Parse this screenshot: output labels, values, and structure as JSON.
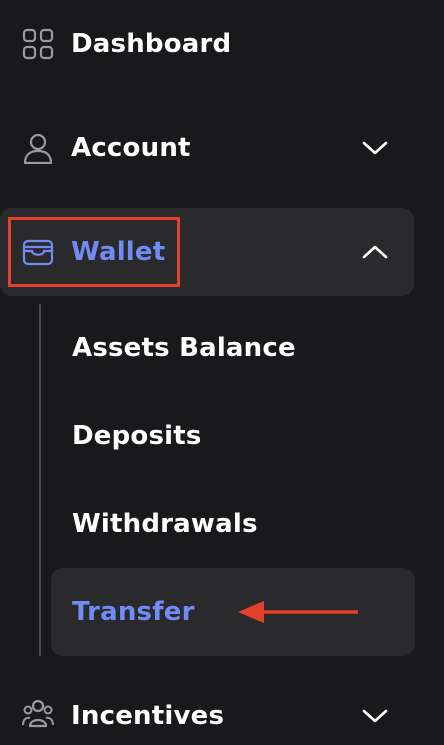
{
  "nav": {
    "dashboard": {
      "label": "Dashboard",
      "icon": "grid-icon"
    },
    "account": {
      "label": "Account",
      "icon": "user-icon",
      "state": "collapsed"
    },
    "wallet": {
      "label": "Wallet",
      "icon": "wallet-icon",
      "state": "expanded",
      "submenu": [
        {
          "label": "Assets Balance"
        },
        {
          "label": "Deposits"
        },
        {
          "label": "Withdrawals"
        },
        {
          "label": "Transfer",
          "active": true
        }
      ]
    },
    "incentives": {
      "label": "Incentives",
      "icon": "group-icon",
      "state": "collapsed"
    }
  },
  "colors": {
    "background": "#19191b",
    "active_bg": "#2a2a2c",
    "accent": "#6f8cf4",
    "annotation": "#e5402b",
    "text": "#ffffff",
    "icon_gray": "#9a9a9e"
  },
  "annotations": {
    "highlight_target": "wallet",
    "arrow_target": "transfer"
  }
}
